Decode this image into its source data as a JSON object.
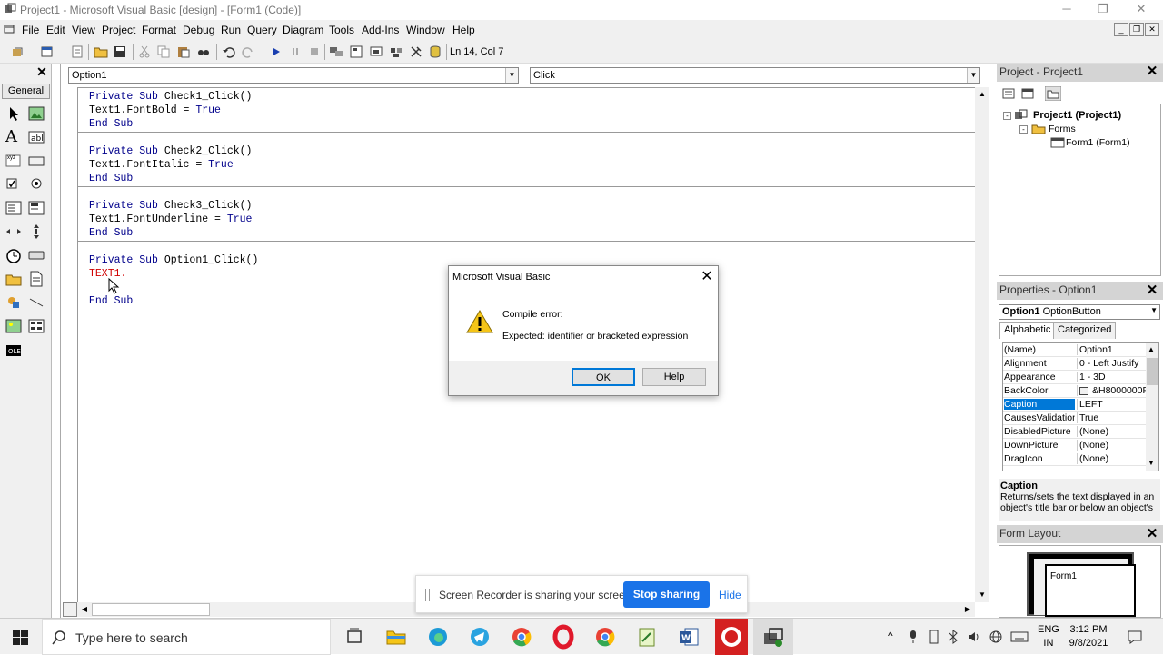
{
  "window": {
    "title": "Project1 - Microsoft Visual Basic [design] - [Form1 (Code)]",
    "controls": [
      "─",
      "❐",
      "✕"
    ]
  },
  "menu": [
    "File",
    "Edit",
    "View",
    "Project",
    "Format",
    "Debug",
    "Run",
    "Query",
    "Diagram",
    "Tools",
    "Add-Ins",
    "Window",
    "Help"
  ],
  "toolbar": {
    "position": "Ln 14, Col 7",
    "icons": [
      "add-project-icon",
      "add-form-icon",
      "menu-editor-icon",
      "open-icon",
      "save-icon",
      "cut-icon",
      "copy-icon",
      "paste-icon",
      "find-icon",
      "undo-icon",
      "redo-icon",
      "start-icon",
      "break-icon",
      "end-icon",
      "project-explorer-icon",
      "properties-window-icon",
      "form-layout-icon",
      "object-browser-icon",
      "toolbox-icon",
      "data-view-icon"
    ]
  },
  "toolbox": {
    "tab": "General",
    "tools": [
      "pointer",
      "picturebox",
      "label",
      "textbox",
      "frame",
      "commandbutton",
      "checkbox",
      "optionbutton",
      "combobox",
      "listbox",
      "hscrollbar",
      "vscrollbar",
      "timer",
      "drivelistbox",
      "dirlistbox",
      "filelistbox",
      "shape",
      "line",
      "image",
      "data",
      "ole"
    ]
  },
  "code": {
    "object_combo": "Option1",
    "procedure_combo": "Click",
    "procedures": [
      {
        "lines": [
          {
            "kw": "Private Sub ",
            "text": "Check1_Click()"
          },
          {
            "text": "Text1.FontBold = ",
            "kw2": "True"
          },
          {
            "kw": "End Sub"
          }
        ]
      },
      {
        "lines": [
          {
            "kw": "Private Sub ",
            "text": "Check2_Click()"
          },
          {
            "text": "Text1.FontItalic = ",
            "kw2": "True"
          },
          {
            "kw": "End Sub"
          }
        ]
      },
      {
        "lines": [
          {
            "kw": "Private Sub ",
            "text": "Check3_Click()"
          },
          {
            "text": "Text1.FontUnderline = ",
            "kw2": "True"
          },
          {
            "kw": "End Sub"
          }
        ]
      },
      {
        "lines": [
          {
            "kw": "Private Sub ",
            "text": "Option1_Click()"
          },
          {
            "err": "TEXT1."
          },
          {
            "text": ""
          },
          {
            "kw": "End Sub"
          }
        ]
      }
    ]
  },
  "dialog": {
    "title": "Microsoft Visual Basic",
    "message1": "Compile error:",
    "message2": "Expected: identifier or bracketed expression",
    "ok": "OK",
    "help": "Help"
  },
  "project": {
    "title": "Project - Project1",
    "root": "Project1 (Project1)",
    "folder": "Forms",
    "item": "Form1 (Form1)"
  },
  "properties": {
    "title": "Properties - Option1",
    "object": "Option1",
    "object_type": "OptionButton",
    "tabs": [
      "Alphabetic",
      "Categorized"
    ],
    "rows": [
      {
        "name": "(Name)",
        "value": "Option1"
      },
      {
        "name": "Alignment",
        "value": "0 - Left Justify"
      },
      {
        "name": "Appearance",
        "value": "1 - 3D"
      },
      {
        "name": "BackColor",
        "value": "&H8000000F"
      },
      {
        "name": "Caption",
        "value": "LEFT",
        "selected": true
      },
      {
        "name": "CausesValidation",
        "value": "True"
      },
      {
        "name": "DisabledPicture",
        "value": "(None)"
      },
      {
        "name": "DownPicture",
        "value": "(None)"
      },
      {
        "name": "DragIcon",
        "value": "(None)"
      }
    ],
    "desc_title": "Caption",
    "desc_text": "Returns/sets the text displayed in an object's title bar or below an object's"
  },
  "form_layout": {
    "title": "Form Layout",
    "form": "Form1"
  },
  "share": {
    "text": "Screen Recorder is sharing your screen.",
    "stop": "Stop sharing",
    "hide": "Hide"
  },
  "taskbar": {
    "search": "Type here to search",
    "lang1": "ENG",
    "lang2": "IN",
    "time": "3:12 PM",
    "date": "9/8/2021"
  },
  "colors": {
    "accent": "#0078d7",
    "keyword": "#00008b",
    "error": "#d00000",
    "share_button": "#1a73e8"
  }
}
